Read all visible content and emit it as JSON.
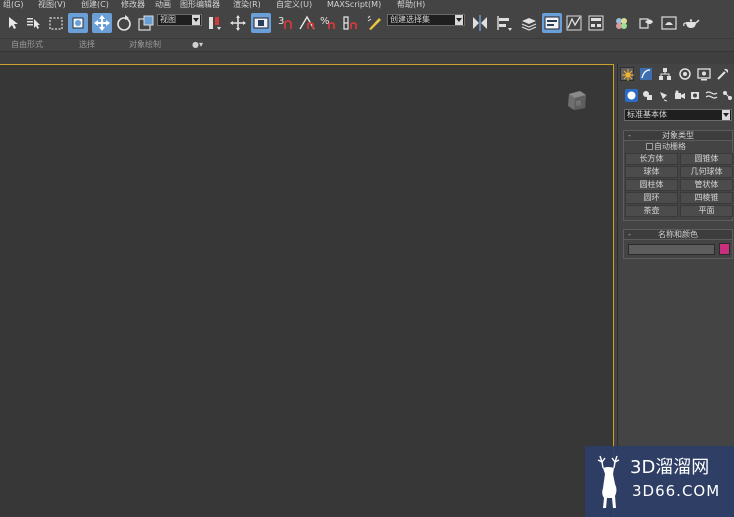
{
  "menu": [
    {
      "label": "组(G)"
    },
    {
      "label": "视图(V)"
    },
    {
      "label": "创建(C)"
    },
    {
      "label": "修改器"
    },
    {
      "label": "动画"
    },
    {
      "label": "图形编辑器"
    },
    {
      "label": "渲染(R)"
    },
    {
      "label": "自定义(U)"
    },
    {
      "label": "MAXScript(M)"
    },
    {
      "label": "帮助(H)"
    }
  ],
  "toolbar": {
    "ref_coord_value": "视图",
    "selection_set_value": "创建选择集",
    "icons": [
      "select-object-icon",
      "select-by-name-icon",
      "rectangular-selection-icon",
      "window-crossing-icon",
      "select-and-move-icon",
      "select-and-rotate-icon",
      "pivot-center-icon",
      "select-manipulate-icon",
      "keyboard-shortcut-icon",
      "snaps-toggle-icon",
      "angle-snap-icon",
      "percent-snap-icon",
      "spinner-snap-icon",
      "edit-named-selection-icon",
      "mirror-icon",
      "align-icon",
      "layer-manager-icon",
      "scene-explorer-icon",
      "curve-editor-icon",
      "schematic-view-icon",
      "material-editor-icon",
      "render-setup-icon",
      "rendered-frame-window-icon",
      "render-teapot-icon"
    ],
    "active_icons": [
      "window-crossing-icon",
      "select-and-move-icon",
      "select-manipulate-icon",
      "scene-explorer-icon"
    ]
  },
  "ribbon": {
    "labels": [
      "自由形式",
      "选择",
      "对象绘制"
    ]
  },
  "panel": {
    "tabs": [
      "create-tab-icon",
      "modify-tab-icon",
      "hierarchy-tab-icon",
      "motion-tab-icon",
      "display-tab-icon",
      "utilities-tab-icon"
    ],
    "subcategories": [
      "geometry-icon",
      "shapes-icon",
      "lights-icon",
      "cameras-icon",
      "helpers-icon",
      "space-warps-icon",
      "systems-icon"
    ],
    "primitive_type": "标准基本体",
    "object_type": {
      "title": "对象类型",
      "autogrid_label": "自动栅格",
      "autogrid_checked": false,
      "buttons": [
        "长方体",
        "圆锥体",
        "球体",
        "几何球体",
        "圆柱体",
        "管状体",
        "圆环",
        "四棱锥",
        "茶壶",
        "平面"
      ]
    },
    "name_color": {
      "title": "名称和颜色",
      "name_value": "",
      "color": "#c8307f"
    }
  },
  "viewport": {
    "border_color": "#c9a227"
  },
  "watermark": {
    "title": "3D溜溜网",
    "url": "3D66.COM"
  },
  "colors": {
    "ui_background": "#444444",
    "viewport_background": "#373737",
    "active_highlight": "#6a9fd8"
  }
}
